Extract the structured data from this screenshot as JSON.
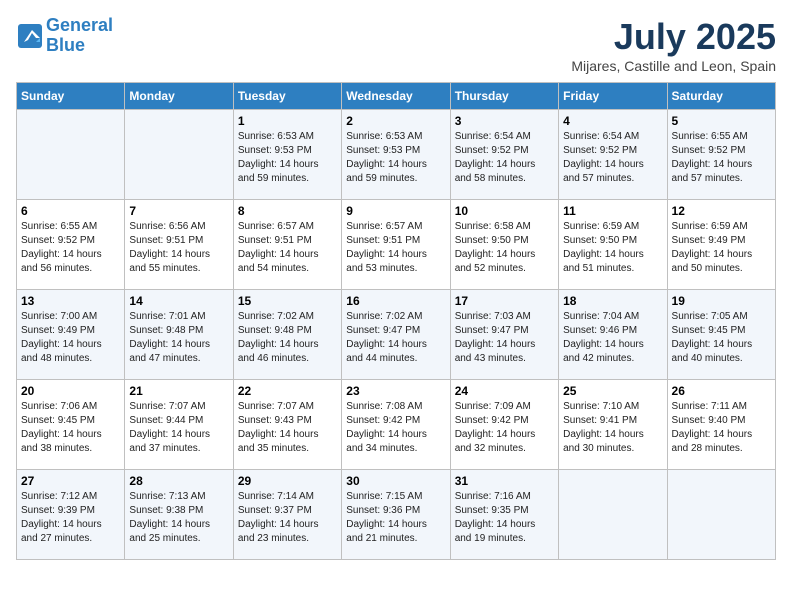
{
  "header": {
    "logo_line1": "General",
    "logo_line2": "Blue",
    "month_title": "July 2025",
    "location": "Mijares, Castille and Leon, Spain"
  },
  "weekdays": [
    "Sunday",
    "Monday",
    "Tuesday",
    "Wednesday",
    "Thursday",
    "Friday",
    "Saturday"
  ],
  "weeks": [
    [
      {
        "day": "",
        "info": ""
      },
      {
        "day": "",
        "info": ""
      },
      {
        "day": "1",
        "info": "Sunrise: 6:53 AM\nSunset: 9:53 PM\nDaylight: 14 hours and 59 minutes."
      },
      {
        "day": "2",
        "info": "Sunrise: 6:53 AM\nSunset: 9:53 PM\nDaylight: 14 hours and 59 minutes."
      },
      {
        "day": "3",
        "info": "Sunrise: 6:54 AM\nSunset: 9:52 PM\nDaylight: 14 hours and 58 minutes."
      },
      {
        "day": "4",
        "info": "Sunrise: 6:54 AM\nSunset: 9:52 PM\nDaylight: 14 hours and 57 minutes."
      },
      {
        "day": "5",
        "info": "Sunrise: 6:55 AM\nSunset: 9:52 PM\nDaylight: 14 hours and 57 minutes."
      }
    ],
    [
      {
        "day": "6",
        "info": "Sunrise: 6:55 AM\nSunset: 9:52 PM\nDaylight: 14 hours and 56 minutes."
      },
      {
        "day": "7",
        "info": "Sunrise: 6:56 AM\nSunset: 9:51 PM\nDaylight: 14 hours and 55 minutes."
      },
      {
        "day": "8",
        "info": "Sunrise: 6:57 AM\nSunset: 9:51 PM\nDaylight: 14 hours and 54 minutes."
      },
      {
        "day": "9",
        "info": "Sunrise: 6:57 AM\nSunset: 9:51 PM\nDaylight: 14 hours and 53 minutes."
      },
      {
        "day": "10",
        "info": "Sunrise: 6:58 AM\nSunset: 9:50 PM\nDaylight: 14 hours and 52 minutes."
      },
      {
        "day": "11",
        "info": "Sunrise: 6:59 AM\nSunset: 9:50 PM\nDaylight: 14 hours and 51 minutes."
      },
      {
        "day": "12",
        "info": "Sunrise: 6:59 AM\nSunset: 9:49 PM\nDaylight: 14 hours and 50 minutes."
      }
    ],
    [
      {
        "day": "13",
        "info": "Sunrise: 7:00 AM\nSunset: 9:49 PM\nDaylight: 14 hours and 48 minutes."
      },
      {
        "day": "14",
        "info": "Sunrise: 7:01 AM\nSunset: 9:48 PM\nDaylight: 14 hours and 47 minutes."
      },
      {
        "day": "15",
        "info": "Sunrise: 7:02 AM\nSunset: 9:48 PM\nDaylight: 14 hours and 46 minutes."
      },
      {
        "day": "16",
        "info": "Sunrise: 7:02 AM\nSunset: 9:47 PM\nDaylight: 14 hours and 44 minutes."
      },
      {
        "day": "17",
        "info": "Sunrise: 7:03 AM\nSunset: 9:47 PM\nDaylight: 14 hours and 43 minutes."
      },
      {
        "day": "18",
        "info": "Sunrise: 7:04 AM\nSunset: 9:46 PM\nDaylight: 14 hours and 42 minutes."
      },
      {
        "day": "19",
        "info": "Sunrise: 7:05 AM\nSunset: 9:45 PM\nDaylight: 14 hours and 40 minutes."
      }
    ],
    [
      {
        "day": "20",
        "info": "Sunrise: 7:06 AM\nSunset: 9:45 PM\nDaylight: 14 hours and 38 minutes."
      },
      {
        "day": "21",
        "info": "Sunrise: 7:07 AM\nSunset: 9:44 PM\nDaylight: 14 hours and 37 minutes."
      },
      {
        "day": "22",
        "info": "Sunrise: 7:07 AM\nSunset: 9:43 PM\nDaylight: 14 hours and 35 minutes."
      },
      {
        "day": "23",
        "info": "Sunrise: 7:08 AM\nSunset: 9:42 PM\nDaylight: 14 hours and 34 minutes."
      },
      {
        "day": "24",
        "info": "Sunrise: 7:09 AM\nSunset: 9:42 PM\nDaylight: 14 hours and 32 minutes."
      },
      {
        "day": "25",
        "info": "Sunrise: 7:10 AM\nSunset: 9:41 PM\nDaylight: 14 hours and 30 minutes."
      },
      {
        "day": "26",
        "info": "Sunrise: 7:11 AM\nSunset: 9:40 PM\nDaylight: 14 hours and 28 minutes."
      }
    ],
    [
      {
        "day": "27",
        "info": "Sunrise: 7:12 AM\nSunset: 9:39 PM\nDaylight: 14 hours and 27 minutes."
      },
      {
        "day": "28",
        "info": "Sunrise: 7:13 AM\nSunset: 9:38 PM\nDaylight: 14 hours and 25 minutes."
      },
      {
        "day": "29",
        "info": "Sunrise: 7:14 AM\nSunset: 9:37 PM\nDaylight: 14 hours and 23 minutes."
      },
      {
        "day": "30",
        "info": "Sunrise: 7:15 AM\nSunset: 9:36 PM\nDaylight: 14 hours and 21 minutes."
      },
      {
        "day": "31",
        "info": "Sunrise: 7:16 AM\nSunset: 9:35 PM\nDaylight: 14 hours and 19 minutes."
      },
      {
        "day": "",
        "info": ""
      },
      {
        "day": "",
        "info": ""
      }
    ]
  ]
}
